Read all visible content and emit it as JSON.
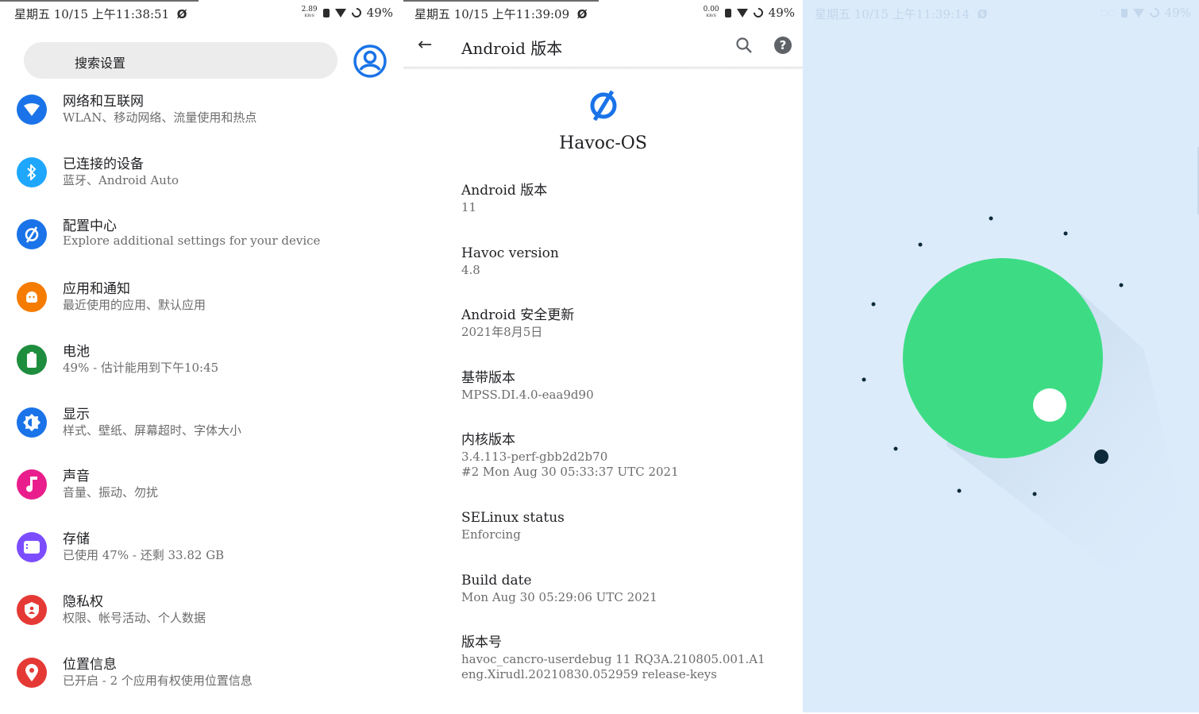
{
  "status_left": {
    "datetime": "星期五 10/15 上午11:38:51",
    "net_speed": "2.89",
    "net_unit": "KB/S",
    "battery": "49%"
  },
  "status_middle": {
    "datetime": "星期五 10/15 上午11:39:09",
    "net_speed": "0.00",
    "net_unit": "KB/S",
    "battery": "49%"
  },
  "status_right": {
    "datetime": "星期五 10/15 上午11:39:14",
    "battery": "49%"
  },
  "settings": {
    "search_label": "搜索设置",
    "items": [
      {
        "title": "网络和互联网",
        "subtitle": "WLAN、移动网络、流量使用和热点",
        "icon": "wifi-icon",
        "color": "#1a73e8"
      },
      {
        "title": "已连接的设备",
        "subtitle": "蓝牙、Android Auto",
        "icon": "bluetooth-icon",
        "color": "#1ea7fd"
      },
      {
        "title": "配置中心",
        "subtitle": "Explore additional settings for your device",
        "icon": "havoc-icon",
        "color": "#1a73e8"
      },
      {
        "title": "应用和通知",
        "subtitle": "最近使用的应用、默认应用",
        "icon": "android-icon",
        "color": "#f57c00"
      },
      {
        "title": "电池",
        "subtitle": "49% - 估计能用到下午10:45",
        "icon": "battery-icon",
        "color": "#1e8e3e"
      },
      {
        "title": "显示",
        "subtitle": "样式、壁纸、屏幕超时、字体大小",
        "icon": "brightness-icon",
        "color": "#1a73e8"
      },
      {
        "title": "声音",
        "subtitle": "音量、振动、勿扰",
        "icon": "music-note-icon",
        "color": "#e91e8c"
      },
      {
        "title": "存储",
        "subtitle": "已使用 47% - 还剩 33.82 GB",
        "icon": "storage-icon",
        "color": "#7c4dff"
      },
      {
        "title": "隐私权",
        "subtitle": "权限、帐号活动、个人数据",
        "icon": "privacy-shield-icon",
        "color": "#e53935"
      },
      {
        "title": "位置信息",
        "subtitle": "已开启 - 2 个应用有权使用位置信息",
        "icon": "location-pin-icon",
        "color": "#e53935"
      }
    ]
  },
  "about": {
    "title": "Android 版本",
    "os_name": "Havoc-OS",
    "items": [
      {
        "label": "Android 版本",
        "value": "11",
        "value2": ""
      },
      {
        "label": "Havoc version",
        "value": "4.8",
        "value2": ""
      },
      {
        "label": "Android 安全更新",
        "value": "2021年8月5日",
        "value2": ""
      },
      {
        "label": "基带版本",
        "value": "MPSS.DI.4.0-eaa9d90",
        "value2": ""
      },
      {
        "label": "内核版本",
        "value": "3.4.113-perf-gbb2d2b70",
        "value2": "#2 Mon Aug 30 05:33:37 UTC 2021"
      },
      {
        "label": "SELinux status",
        "value": "Enforcing",
        "value2": ""
      },
      {
        "label": "Build date",
        "value": "Mon Aug 30 05:29:06 UTC 2021",
        "value2": ""
      },
      {
        "label": "版本号",
        "value": "havoc_cancro-userdebug 11 RQ3A.210805.001.A1",
        "value2": "eng.Xirudl.20210830.052959 release-keys"
      }
    ]
  },
  "colors": {
    "egg_background": "#dcebfa",
    "egg_circle": "#3ddc84",
    "egg_dot": "#0d2a3a"
  }
}
